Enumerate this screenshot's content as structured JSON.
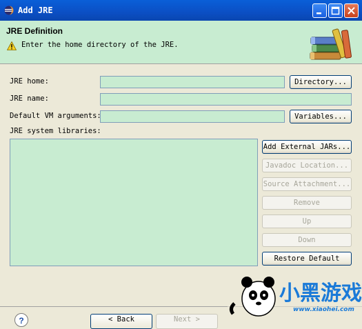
{
  "window": {
    "title": "Add JRE"
  },
  "header": {
    "title": "JRE Definition",
    "message": "Enter the home directory of the JRE."
  },
  "form": {
    "jre_home_label": "JRE home:",
    "jre_home_value": "",
    "jre_name_label": "JRE name:",
    "jre_name_value": "",
    "vm_args_label": "Default VM arguments:",
    "vm_args_value": "",
    "libraries_label": "JRE system libraries:"
  },
  "buttons": {
    "directory": "Directory...",
    "variables": "Variables...",
    "add_external_jars": "Add External JARs...",
    "javadoc_location": "Javadoc Location...",
    "source_attachment": "Source Attachment...",
    "remove": "Remove",
    "up": "Up",
    "down": "Down",
    "restore_default": "Restore Default"
  },
  "footer": {
    "help": "?",
    "back": "< Back",
    "next": "Next >"
  },
  "watermark": {
    "site": "www.xiaohei.com",
    "brand": "小黑游戏"
  },
  "icons": {
    "app": "eclipse-icon",
    "warning": "warning-icon",
    "header_graphic": "books-icon"
  },
  "colors": {
    "titlebar": "#0b4fc4",
    "header_bg": "#c8ecd1",
    "field_bg": "#c8ecd1",
    "dialog_bg": "#ece9d8"
  }
}
